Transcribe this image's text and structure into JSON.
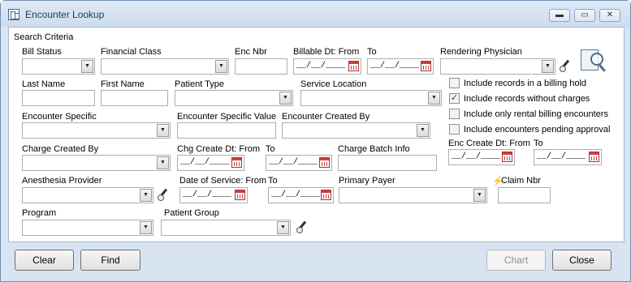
{
  "window": {
    "title": "Encounter Lookup",
    "controls": {
      "minimize": "▬",
      "maximize": "▭",
      "close": "✕"
    }
  },
  "section": {
    "legend": "Search Criteria"
  },
  "labels": {
    "bill_status": "Bill Status",
    "financial_class": "Financial Class",
    "enc_nbr": "Enc Nbr",
    "billable_from": "Billable Dt:  From",
    "billable_to": "To",
    "rendering_physician": "Rendering Physician",
    "last_name": "Last Name",
    "first_name": "First Name",
    "patient_type": "Patient Type",
    "service_location": "Service Location",
    "encounter_specific": "Encounter Specific",
    "encounter_specific_value": "Encounter Specific Value",
    "encounter_created_by": "Encounter Created By",
    "charge_created_by": "Charge Created By",
    "chg_create_from": "Chg Create Dt: From",
    "chg_create_to": "To",
    "charge_batch_info": "Charge Batch Info",
    "enc_create_from": "Enc Create Dt: From",
    "enc_create_to": "To",
    "anesthesia_provider": "Anesthesia Provider",
    "dos_from": "Date of Service: From",
    "dos_to": "To",
    "primary_payer": "Primary Payer",
    "claim_nbr": "Claim Nbr",
    "program": "Program",
    "patient_group": "Patient Group"
  },
  "date_placeholder": "__/__/____",
  "checkboxes": [
    {
      "label": "Include records in a billing hold",
      "checked": false
    },
    {
      "label": "Include records without charges",
      "checked": true
    },
    {
      "label": "Include only rental billing encounters",
      "checked": false
    },
    {
      "label": "Include encounters pending approval",
      "checked": false
    }
  ],
  "buttons": {
    "clear": "Clear",
    "find": "Find",
    "chart": "Chart",
    "close": "Close"
  },
  "glyphs": {
    "combo_arrow": "▼",
    "check": "✓",
    "bolt": "⚡"
  }
}
